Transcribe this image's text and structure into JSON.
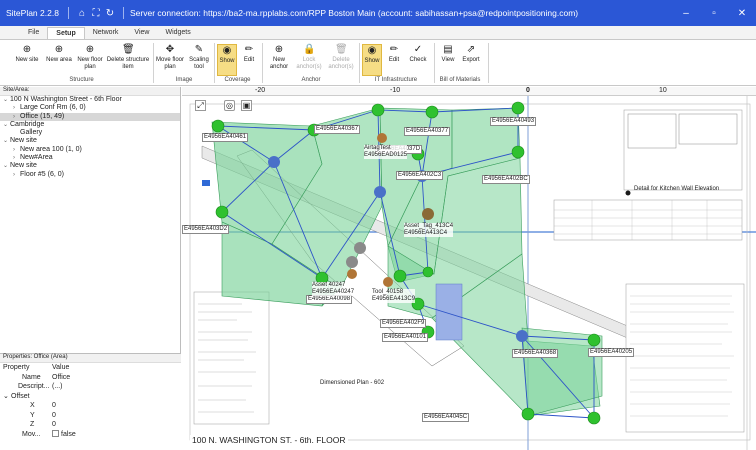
{
  "titlebar": {
    "app_name": "SitePlan 2.2.8",
    "connection": "Server connection: https://ba2-ma.rpplabs.com/RPP Boston Main (account: sabihassan+psa@redpointpositioning.com)",
    "minimize": "–",
    "restore": "▫",
    "close": "✕"
  },
  "tabs": [
    "File",
    "Setup",
    "Network",
    "View",
    "Widgets"
  ],
  "ribbon": {
    "buttons": [
      {
        "label": "New site",
        "icon": "plus-circle-icon"
      },
      {
        "label": "New area",
        "icon": "plus-circle-icon"
      },
      {
        "label": "New floor plan",
        "icon": "plus-circle-icon"
      },
      {
        "label": "Delete structure item",
        "icon": "trash-icon"
      },
      {
        "label": "Move floor plan",
        "icon": "move-icon"
      },
      {
        "label": "Scaling tool",
        "icon": "ruler-icon"
      },
      {
        "label": "Show",
        "icon": "eye-icon"
      },
      {
        "label": "Edit",
        "icon": "pencil-icon"
      },
      {
        "label": "New anchor",
        "icon": "plus-circle-icon"
      },
      {
        "label": "Lock anchor(s)",
        "icon": "lock-icon"
      },
      {
        "label": "Delete anchor(s)",
        "icon": "trash-icon"
      },
      {
        "label": "Show",
        "icon": "eye-icon"
      },
      {
        "label": "Edit",
        "icon": "pencil-icon"
      },
      {
        "label": "Check",
        "icon": "check-icon"
      },
      {
        "label": "View",
        "icon": "document-icon"
      },
      {
        "label": "Export",
        "icon": "export-icon"
      }
    ],
    "groups": [
      "Structure",
      "Image",
      "Coverage",
      "Anchor",
      "IT Infrastructure",
      "Bill of Materials"
    ]
  },
  "site_header": "Site/Area:",
  "tree": [
    {
      "label": "100 N Washington Street - 6th Floor",
      "indent": 0,
      "expanded": true
    },
    {
      "label": "Large Conf Rm (6, 0)",
      "indent": 1,
      "expanded": false
    },
    {
      "label": "Office (15, 49)",
      "indent": 1,
      "expanded": false,
      "selected": true
    },
    {
      "label": "Cambridge",
      "indent": 0,
      "expanded": true
    },
    {
      "label": "Gallery",
      "indent": 1,
      "leaf": true
    },
    {
      "label": "New site",
      "indent": 0,
      "expanded": true
    },
    {
      "label": "New area 100 (1, 0)",
      "indent": 1,
      "expanded": false
    },
    {
      "label": "New#Area",
      "indent": 1,
      "expanded": false
    },
    {
      "label": "New site",
      "indent": 0,
      "expanded": true
    },
    {
      "label": "Floor #5 (6, 0)",
      "indent": 1,
      "expanded": false
    }
  ],
  "properties": {
    "header": "Properties: Office (Area)",
    "col_property": "Property",
    "col_value": "Value",
    "name_key": "Name",
    "name_val": "Office",
    "descr_key": "Descript...",
    "descr_val": "(...)",
    "offset_key": "Offset",
    "x_key": "X",
    "x_val": "0",
    "y_key": "Y",
    "y_val": "0",
    "z_key": "Z",
    "z_val": "0",
    "mov_key": "Mov...",
    "mov_val": "false"
  },
  "canvas": {
    "ruler_ticks": [
      "-20",
      "-10",
      "0",
      "10"
    ],
    "floor_title": "100 N. WASHINGTON ST. - 6th. FLOOR",
    "plan_label": "Dimensioned Plan - 602",
    "detail_label": "Detail for Kitchen Wall Elevation",
    "coverage_color": "#7bd39a",
    "anchor_color": "#2fc12f",
    "hub_color": "#4a70c8",
    "anchors": [
      {
        "label": "E4956EA40461"
      },
      {
        "label": "E4956EA40367"
      },
      {
        "label": "E4956EA40377"
      },
      {
        "label": "E4956EA40493"
      },
      {
        "label": "E4956EA4037D"
      },
      {
        "label": "E4956EA403D2"
      },
      {
        "label": "E4956EA402C3"
      },
      {
        "label": "E4956EA402BC"
      },
      {
        "label": "E4956EA40098"
      },
      {
        "label": "E4956EA402F9"
      },
      {
        "label": "E4956EA40101"
      },
      {
        "label": "E4956EA40368"
      },
      {
        "label": "E4956EA40205"
      },
      {
        "label": "E4956EA4045C"
      }
    ],
    "assets": [
      {
        "label": "AirtagTest",
        "sub": "E4956EAD0125"
      },
      {
        "label": "Asset_Tag_413C4",
        "sub": "E4956EA413C4"
      },
      {
        "label": "Asset 40247",
        "sub": "E4956EA40247"
      },
      {
        "label": "Tool_40158",
        "sub": "E4956EA413C9"
      }
    ]
  }
}
